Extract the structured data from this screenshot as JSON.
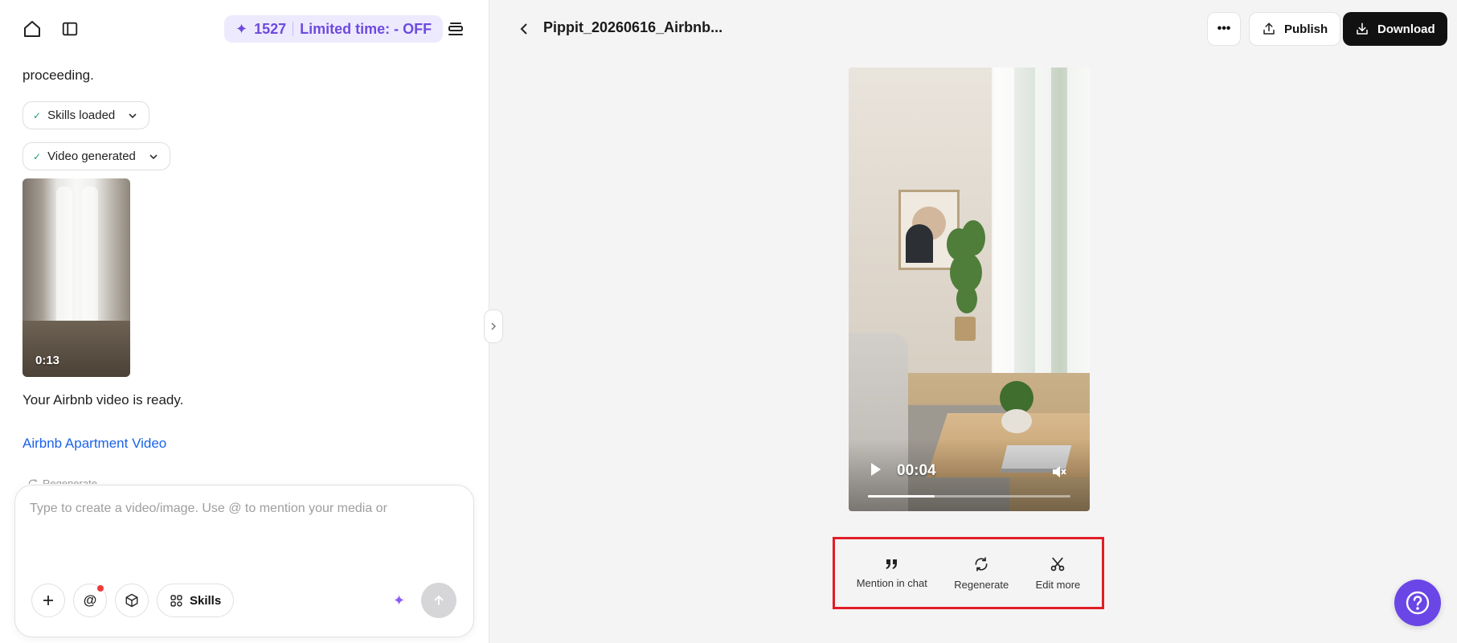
{
  "left_panel": {
    "promo": {
      "credits": "1527",
      "offer": "Limited time: - OFF"
    },
    "chat": {
      "truncated_text": "proceeding.",
      "status_pills": [
        {
          "label": "Skills loaded"
        },
        {
          "label": "Video generated"
        }
      ],
      "video_thumb": {
        "duration": "0:13"
      },
      "ready_message": "Your Airbnb video is ready.",
      "video_link": "Airbnb Apartment Video",
      "regenerate_label": "Regenerate"
    },
    "composer": {
      "placeholder": "Type to create a video/image. Use @ to mention your media or",
      "value": "",
      "skills_label": "Skills"
    }
  },
  "header": {
    "title": "Pippit_20260616_Airbnb...",
    "publish_label": "Publish",
    "download_label": "Download"
  },
  "player": {
    "time": "00:04",
    "progress": 0.33
  },
  "actions": [
    {
      "label": "Mention in chat",
      "icon": "quote-icon"
    },
    {
      "label": "Regenerate",
      "icon": "refresh-icon"
    },
    {
      "label": "Edit more",
      "icon": "scissors-icon"
    }
  ],
  "colors": {
    "accent": "#6d4ae0",
    "promo_bg": "#eeeafe",
    "link": "#1a63e8",
    "highlight_border": "#e11d26",
    "help_button": "#6a46e6",
    "download_bg": "#111111",
    "check": "#17a36b"
  }
}
